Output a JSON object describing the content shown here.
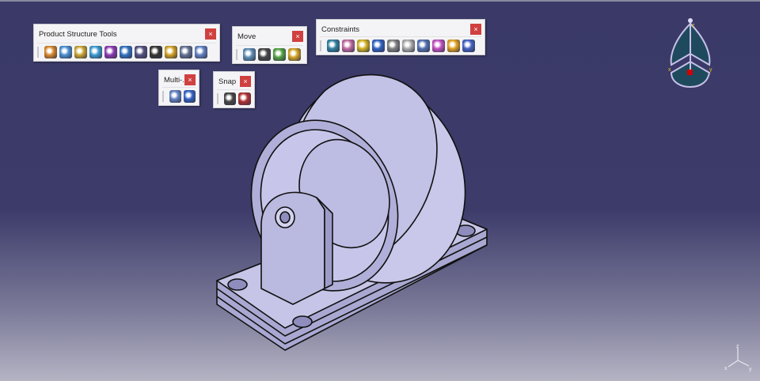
{
  "toolbars": [
    {
      "title": "Product Structure Tools",
      "close": "×",
      "icons": [
        "new-component-icon",
        "new-product-icon",
        "new-part-icon",
        "existing-component-icon",
        "existing-component-positioning-icon",
        "replace-component-icon",
        "graph-tree-reordering-icon",
        "generate-numbering-icon",
        "selective-load-icon",
        "manage-representations-icon",
        "multi-instantiation-icon"
      ],
      "colors": [
        "#d6862a",
        "#4a8fd0",
        "#c9a431",
        "#3a9ad0",
        "#8a3ab0",
        "#3070c0",
        "#505080",
        "#333",
        "#d0a020",
        "#607090",
        "#6080c0"
      ]
    },
    {
      "title": "Move",
      "close": "×",
      "icons": [
        "manipulation-icon",
        "snap-icon",
        "explode-icon",
        "stop-manipulate-on-clash-icon"
      ],
      "colors": [
        "#5a8ab0",
        "#444",
        "#50a040",
        "#d0a020"
      ]
    },
    {
      "title": "Constraints",
      "close": "×",
      "icons": [
        "coincidence-constraint-icon",
        "contact-constraint-icon",
        "offset-constraint-icon",
        "angle-constraint-icon",
        "fix-component-icon",
        "fix-together-icon",
        "quick-constraint-icon",
        "flexible-rigid-subassembly-icon",
        "change-constraint-icon",
        "reuse-pattern-icon"
      ],
      "colors": [
        "#2f7f9f",
        "#c06aa0",
        "#d0b020",
        "#3060c0",
        "#808080",
        "#aaa",
        "#5070b0",
        "#c050c0",
        "#e0a020",
        "#4060c0"
      ]
    },
    {
      "title": "Multi-...",
      "close": "×",
      "icons": [
        "multi-instantiation-icon",
        "fast-multi-instantiation-icon"
      ],
      "colors": [
        "#6080c0",
        "#3060c0"
      ]
    },
    {
      "title": "Snap",
      "close": "×",
      "icons": [
        "snap-icon",
        "smart-move-icon"
      ],
      "colors": [
        "#444",
        "#b03030"
      ]
    }
  ],
  "compass": {
    "labels": [
      "z",
      "x",
      "y"
    ]
  },
  "axis": {
    "labels": [
      "z",
      "x",
      "y"
    ]
  }
}
